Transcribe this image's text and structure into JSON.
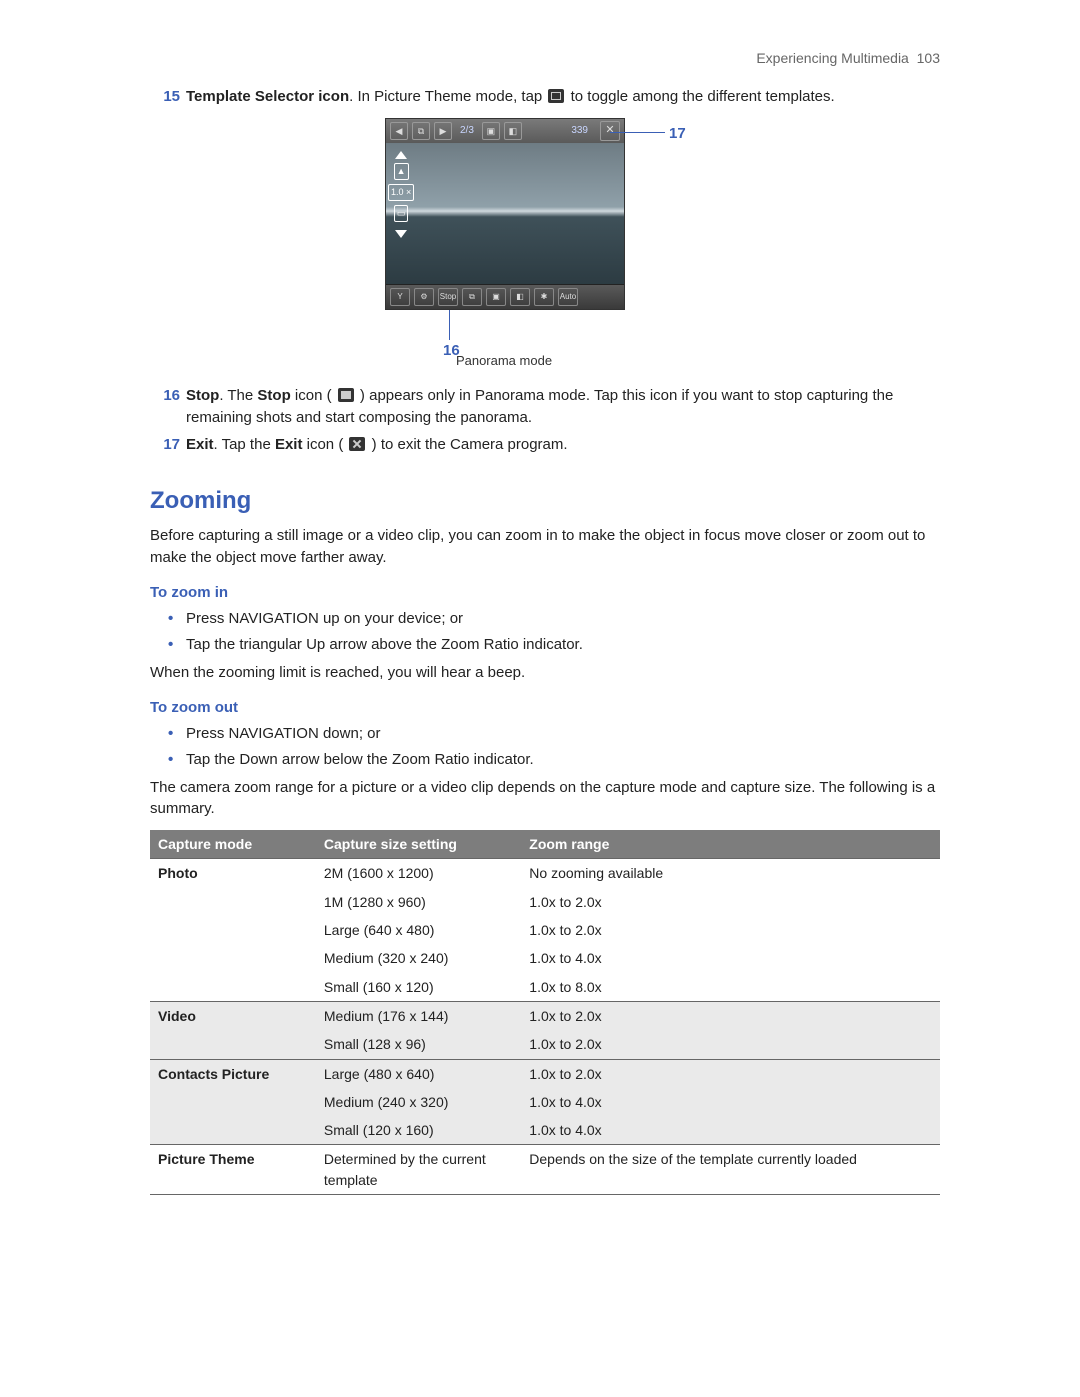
{
  "header": {
    "section": "Experiencing Multimedia",
    "page_number": "103"
  },
  "items": {
    "i15": {
      "num": "15",
      "title": "Template Selector icon",
      "text_before": ". In Picture Theme mode, tap ",
      "text_after": " to toggle among the different templates."
    },
    "i16": {
      "num": "16",
      "title": "Stop",
      "text_a": ". The ",
      "bold_b": "Stop",
      "text_c": " icon ( ",
      "text_d": " ) appears only in Panorama mode. Tap this icon if you want to stop capturing the remaining shots and start composing the panorama."
    },
    "i17": {
      "num": "17",
      "title": "Exit",
      "text_a": ". Tap the ",
      "bold_b": "Exit",
      "text_c": " icon ( ",
      "text_d": " ) to exit the Camera program."
    }
  },
  "figure": {
    "callout_17": "17",
    "callout_16": "16",
    "caption": "Panorama mode",
    "topbar": {
      "fraction": "2/3",
      "count": "339",
      "arrow_left": "◀",
      "arrow_right": "▶",
      "close": "✕"
    },
    "left": {
      "zoom": "1.0 ×"
    },
    "bottom_labels": [
      "Y",
      "⚙",
      "Stop",
      "⧉",
      "▣",
      "◧",
      "✱",
      "Auto"
    ]
  },
  "zooming": {
    "heading": "Zooming",
    "intro": "Before capturing a still image or a video clip, you can zoom in to make the object in focus move closer or zoom out to make the object move farther away.",
    "zoom_in_title": "To zoom in",
    "zoom_in_bullets": [
      "Press NAVIGATION up on your device; or",
      "Tap the triangular Up arrow above the Zoom Ratio indicator."
    ],
    "zoom_in_note": "When the zooming limit is reached, you will hear a beep.",
    "zoom_out_title": "To zoom out",
    "zoom_out_bullets": [
      "Press NAVIGATION down; or",
      "Tap the Down arrow below the Zoom Ratio indicator."
    ],
    "range_intro": "The camera zoom range for a picture or a video clip depends on the capture mode and capture size. The following is a summary."
  },
  "table": {
    "headers": {
      "c1": "Capture mode",
      "c2": "Capture size setting",
      "c3": "Zoom range"
    },
    "groups": [
      {
        "mode": "Photo",
        "shade": "odd",
        "rows": [
          {
            "size": "2M (1600 x 1200)",
            "range": "No zooming available"
          },
          {
            "size": "1M (1280 x 960)",
            "range": "1.0x to 2.0x"
          },
          {
            "size": "Large (640 x 480)",
            "range": "1.0x to 2.0x"
          },
          {
            "size": "Medium (320 x 240)",
            "range": "1.0x to 4.0x"
          },
          {
            "size": "Small (160 x 120)",
            "range": "1.0x to 8.0x"
          }
        ]
      },
      {
        "mode": "Video",
        "shade": "even",
        "rows": [
          {
            "size": "Medium (176 x 144)",
            "range": "1.0x to 2.0x"
          },
          {
            "size": "Small (128 x 96)",
            "range": "1.0x to 2.0x"
          }
        ]
      },
      {
        "mode": "Contacts Picture",
        "shade": "even",
        "rows": [
          {
            "size": "Large (480 x 640)",
            "range": "1.0x to 2.0x"
          },
          {
            "size": "Medium (240 x 320)",
            "range": "1.0x to 4.0x"
          },
          {
            "size": "Small (120 x 160)",
            "range": "1.0x to 4.0x"
          }
        ]
      },
      {
        "mode": "Picture Theme",
        "shade": "odd",
        "rows": [
          {
            "size": "Determined by the current template",
            "range": "Depends on the size of the template currently loaded"
          }
        ]
      }
    ]
  }
}
